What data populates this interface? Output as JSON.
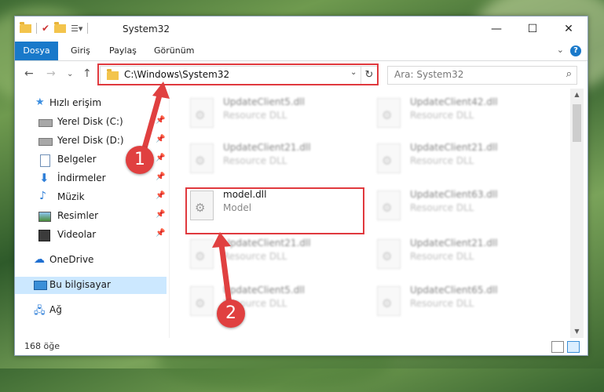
{
  "window": {
    "title": "System32",
    "controls": {
      "minimize": "—",
      "maximize": "☐",
      "close": "✕"
    }
  },
  "ribbon": {
    "tabs": [
      {
        "label": "Dosya",
        "active": true
      },
      {
        "label": "Giriş",
        "active": false
      },
      {
        "label": "Paylaş",
        "active": false
      },
      {
        "label": "Görünüm",
        "active": false
      }
    ],
    "help": "?",
    "collapse": "⌄"
  },
  "nav": {
    "back": "←",
    "forward": "→",
    "recent": "⌄",
    "up": "↑",
    "address": "C:\\Windows\\System32",
    "address_dropdown": "⌄",
    "refresh": "↻",
    "search_placeholder": "Ara: System32",
    "search_icon": "⌕"
  },
  "sidebar": {
    "items": [
      {
        "label": "Hızlı erişim",
        "icon": "star-icon",
        "pinned": false
      },
      {
        "label": "Yerel Disk (C:)",
        "icon": "drive-icon",
        "pinned": true
      },
      {
        "label": "Yerel Disk (D:)",
        "icon": "drive-icon",
        "pinned": true
      },
      {
        "label": "Belgeler",
        "icon": "document-icon",
        "pinned": true
      },
      {
        "label": "İndirmeler",
        "icon": "download-icon",
        "pinned": true
      },
      {
        "label": "Müzik",
        "icon": "music-icon",
        "pinned": true
      },
      {
        "label": "Resimler",
        "icon": "picture-icon",
        "pinned": true
      },
      {
        "label": "Videolar",
        "icon": "video-icon",
        "pinned": true
      },
      {
        "label": "OneDrive",
        "icon": "cloud-icon",
        "pinned": false
      },
      {
        "label": "Bu bilgisayar",
        "icon": "computer-icon",
        "pinned": false,
        "selected": true
      },
      {
        "label": "Ağ",
        "icon": "network-icon",
        "pinned": false
      }
    ],
    "pin_glyph": "📌"
  },
  "files": [
    {
      "name": "UpdateClient5.dll",
      "desc": "Resource DLL",
      "blurred": true
    },
    {
      "name": "UpdateClient42.dll",
      "desc": "Resource DLL",
      "blurred": true
    },
    {
      "name": "UpdateClient21.dll",
      "desc": "Resource DLL",
      "blurred": true
    },
    {
      "name": "UpdateClient21.dll",
      "desc": "Resource DLL",
      "blurred": true
    },
    {
      "name": "model.dll",
      "desc": "Model",
      "blurred": false
    },
    {
      "name": "UpdateClient63.dll",
      "desc": "Resource DLL",
      "blurred": true
    },
    {
      "name": "UpdateClient21.dll",
      "desc": "Resource DLL",
      "blurred": true
    },
    {
      "name": "UpdateClient21.dll",
      "desc": "Resource DLL",
      "blurred": true
    },
    {
      "name": "UpdateClient5.dll",
      "desc": "Resource DLL",
      "blurred": true
    },
    {
      "name": "UpdateClient65.dll",
      "desc": "Resource DLL",
      "blurred": true
    }
  ],
  "status": {
    "count": "168 öğe"
  },
  "annotations": [
    {
      "number": "1"
    },
    {
      "number": "2"
    }
  ],
  "colors": {
    "accent": "#1979ca",
    "highlight": "#e0393e",
    "selected_bg": "#cce8ff"
  }
}
